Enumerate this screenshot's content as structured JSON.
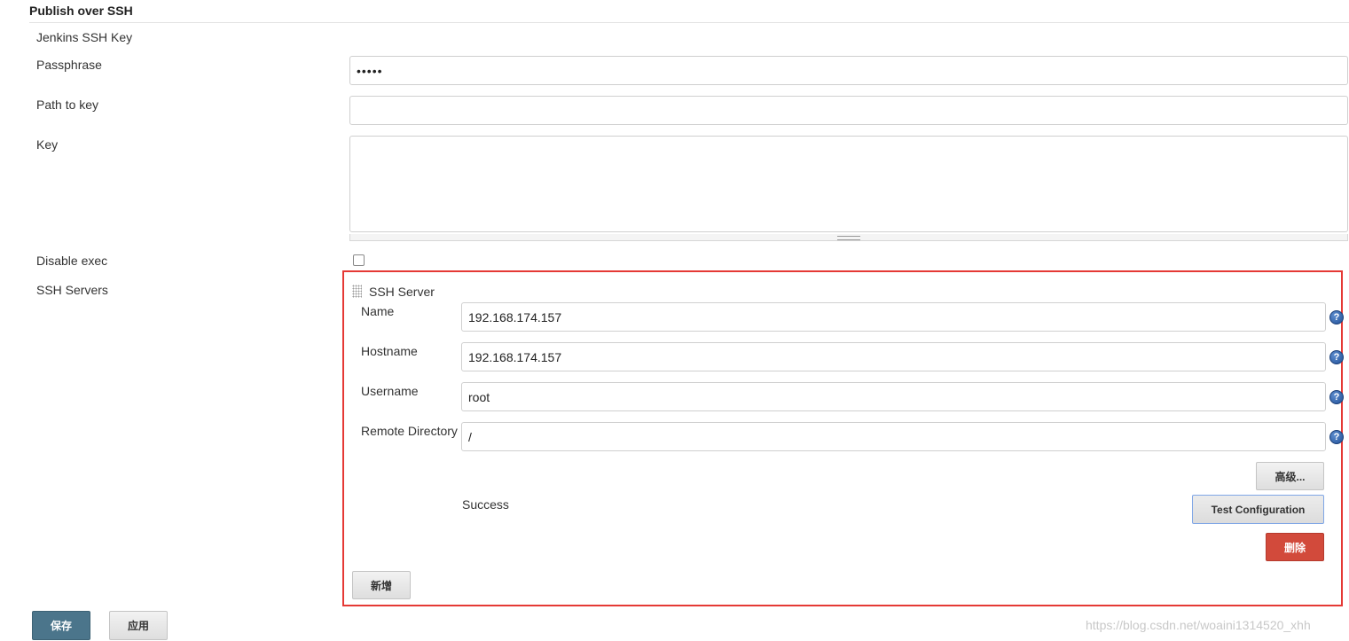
{
  "section": {
    "title": "Publish over SSH"
  },
  "labels": {
    "jenkins_ssh_key": "Jenkins SSH Key",
    "passphrase": "Passphrase",
    "path_to_key": "Path to key",
    "key": "Key",
    "disable_exec": "Disable exec",
    "ssh_servers": "SSH Servers"
  },
  "fields": {
    "passphrase_value": "•••••",
    "path_to_key_value": "",
    "key_value": "",
    "disable_exec_checked": false
  },
  "ssh_server": {
    "header": "SSH Server",
    "name_label": "Name",
    "name_value": "192.168.174.157",
    "hostname_label": "Hostname",
    "hostname_value": "192.168.174.157",
    "username_label": "Username",
    "username_value": "root",
    "remote_dir_label": "Remote Directory",
    "remote_dir_value": "/",
    "advanced_button": "高级...",
    "status_text": "Success",
    "test_button": "Test Configuration",
    "delete_button": "删除",
    "help_glyph": "?"
  },
  "add_button": "新增",
  "footer": {
    "save_button": "保存",
    "apply_button": "应用"
  },
  "watermark": "https://blog.csdn.net/woaini1314520_xhh",
  "colors": {
    "highlight_border": "#e53935",
    "delete_button": "#d24a3b",
    "save_button": "#4b758b",
    "help_icon": "#2b5aa8"
  }
}
